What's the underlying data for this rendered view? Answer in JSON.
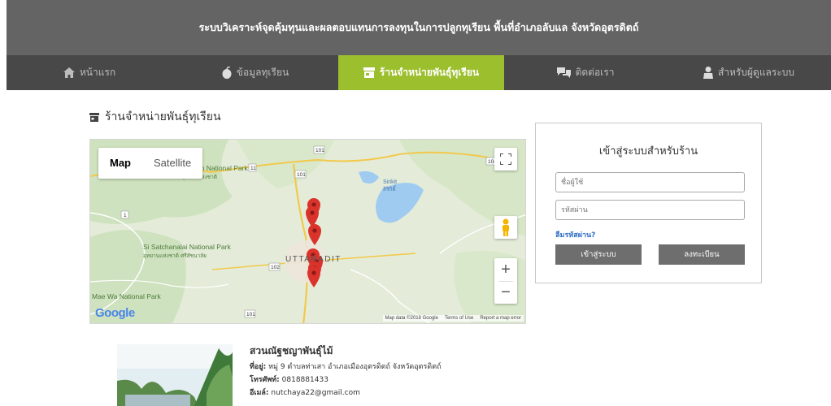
{
  "header": {
    "title": "ระบบวิเคราะห์จุดคุ้มทุนและผลตอบแทนการลงทุนในการปลูกทุเรียน พื้นที่อำเภอลับแล จังหวัดอุตรดิตถ์"
  },
  "nav": {
    "items": [
      {
        "label": "หน้าแรก",
        "icon": "home-icon"
      },
      {
        "label": "ข้อมูลทุเรียน",
        "icon": "durian-icon"
      },
      {
        "label": "ร้านจำหน่ายพันธุ์ทุเรียน",
        "icon": "store-icon",
        "active": true
      },
      {
        "label": "ติดต่อเรา",
        "icon": "chat-icon"
      },
      {
        "label": "สำหรับผู้ดูแลระบบ",
        "icon": "user-icon"
      }
    ],
    "active_color": "#9cbf2e"
  },
  "page": {
    "title": "ร้านจำหน่ายพันธุ์ทุเรียน"
  },
  "map": {
    "type_map": "Map",
    "type_satellite": "Satellite",
    "labels": {
      "sri_park": "Sri Nan National Park",
      "sri_th": "อุทยานแห่งชาติ",
      "si_satchanalai": "Si Satchanalai National Park",
      "si_th": "อุทยานแห่งชาติ ศรีสัชนาลัย",
      "mae_wa": "Mae Wa National Park",
      "sirikit": "Sirikit",
      "sirikit_th": "สิริกิติ์",
      "uttaradit": "UTTARADIT",
      "r101a": "101",
      "r11": "11",
      "r101b": "101",
      "r1": "1",
      "r102": "102",
      "r101c": "101",
      "r104": "104"
    },
    "zoom_in": "+",
    "zoom_out": "−",
    "map_data": "Map data ©2018 Google",
    "terms": "Terms of Use",
    "report": "Report a map error",
    "google": "Google"
  },
  "login": {
    "title": "เข้าสู่ระบบสำหรับร้าน",
    "username_placeholder": "ชื่อผู้ใช้",
    "password_placeholder": "รหัสผ่าน",
    "forgot": "ลืมรหัสผ่าน?",
    "login_button": "เข้าสู่ระบบ",
    "register_button": "ลงทะเบียน"
  },
  "shop": {
    "name": "สวนณัฐชญาพันธุ์ไม้",
    "address_label": "ที่อยู่:",
    "address": "หมู่ 9 ตำบลท่าเสา อำเภอเมืองอุตรดิตถ์ จังหวัดอุตรดิตถ์",
    "phone_label": "โทรศัพท์:",
    "phone": "0818881433",
    "email_label": "อีเมล์:",
    "email": "nutchaya22@gmail.com"
  }
}
